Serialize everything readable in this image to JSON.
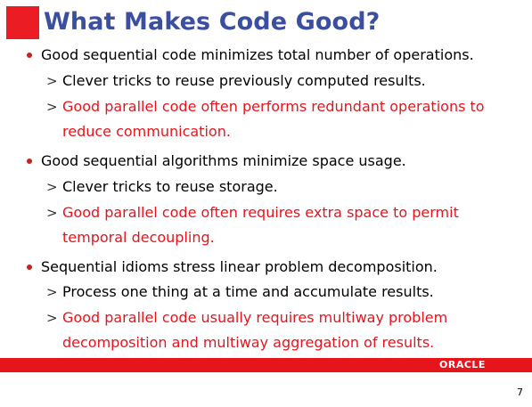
{
  "slide": {
    "title": "What Makes Code Good?",
    "bullets": [
      {
        "text": "Good sequential code minimizes total number of operations.",
        "subs": [
          {
            "lines": [
              "Clever tricks to reuse previously computed results."
            ],
            "red": false
          },
          {
            "lines": [
              "Good parallel code often performs redundant operations to",
              "reduce communication."
            ],
            "red": true
          }
        ]
      },
      {
        "text": "Good sequential algorithms minimize space usage.",
        "subs": [
          {
            "lines": [
              "Clever tricks to reuse storage."
            ],
            "red": false
          },
          {
            "lines": [
              "Good parallel code often requires extra space to permit",
              "temporal decoupling."
            ],
            "red": true
          }
        ]
      },
      {
        "text": "Sequential idioms stress linear problem decomposition.",
        "subs": [
          {
            "lines": [
              "Process one thing at a time and accumulate results."
            ],
            "red": false
          },
          {
            "lines": [
              "Good parallel code usually requires multiway problem",
              "decomposition and multiway aggregation of results."
            ],
            "red": true
          }
        ]
      }
    ],
    "sub_marker": ">",
    "logo_text": "ORACLE",
    "page_number": "7"
  },
  "colors": {
    "title": "#3b4fa1",
    "accent_red": "#e8141c",
    "bullet_dot": "#cc1f1f"
  },
  "icons": {
    "bullet": "red-dot-bullet",
    "sub_bullet": "greater-than-marker",
    "corner": "red-square-decoration"
  }
}
